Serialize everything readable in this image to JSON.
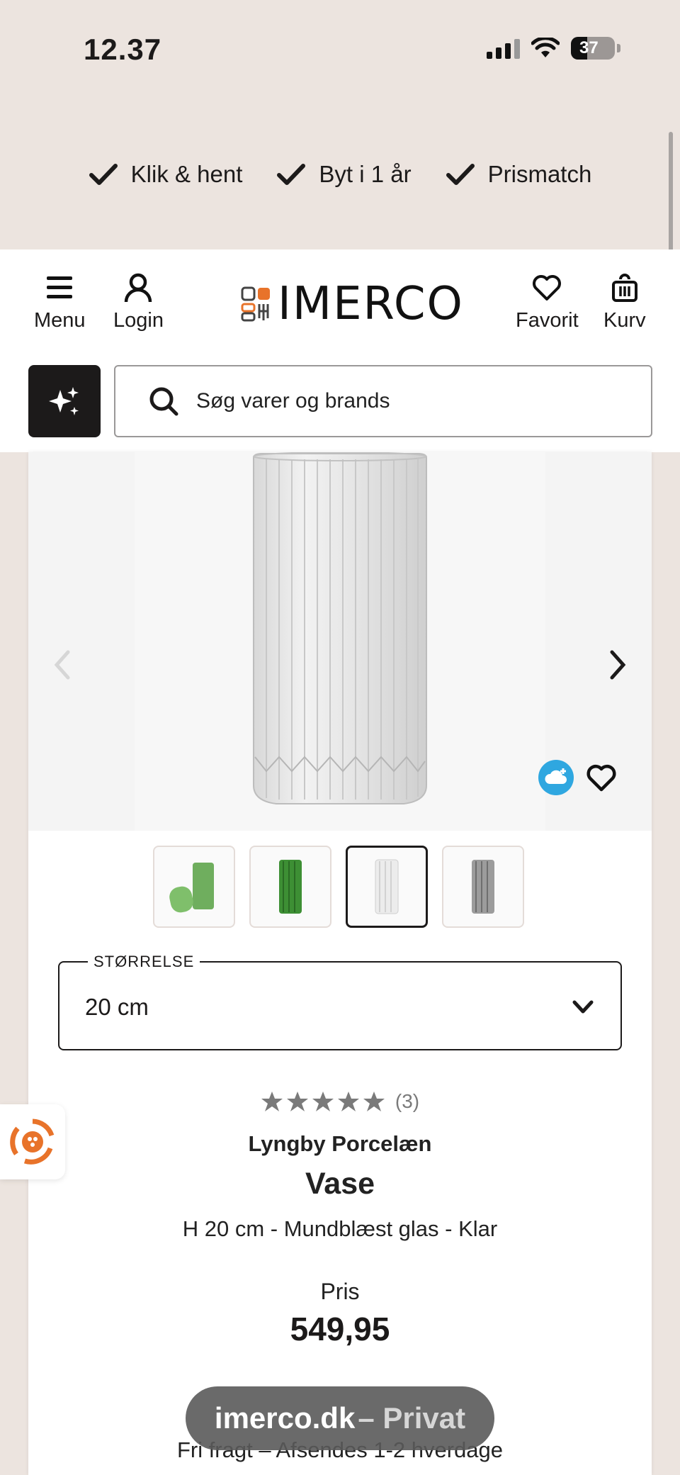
{
  "status_bar": {
    "time": "12.37",
    "battery": "37",
    "battery_level": 0.37
  },
  "usp": [
    {
      "label": "Klik & hent"
    },
    {
      "label": "Byt i 1 år"
    },
    {
      "label": "Prismatch"
    }
  ],
  "header": {
    "menu_label": "Menu",
    "login_label": "Login",
    "logo_text": "IMERCO",
    "favorite_label": "Favorit",
    "cart_label": "Kurv",
    "search_placeholder": "Søg varer og brands"
  },
  "product": {
    "size_label": "STØRRELSE",
    "size_value": "20 cm",
    "rating": 5,
    "review_count": "(3)",
    "brand": "Lyngby Porcelæn",
    "name": "Vase",
    "description": "H 20 cm - Mundblæst glas - Klar",
    "price_label": "Pris",
    "price": "549,95",
    "shipping": "Fri fragt – Afsendes 1-2 hverdage",
    "thumbnails": [
      {
        "color": "green-frosted"
      },
      {
        "color": "green"
      },
      {
        "color": "clear",
        "active": true
      },
      {
        "color": "smoke"
      }
    ]
  },
  "browser": {
    "domain": "imerco.dk",
    "mode": " – Privat"
  },
  "colors": {
    "accent_bg": "#ece4df",
    "dark": "#1c1a1a",
    "cloud": "#2fa7e0",
    "logo_orange": "#e8732a"
  }
}
